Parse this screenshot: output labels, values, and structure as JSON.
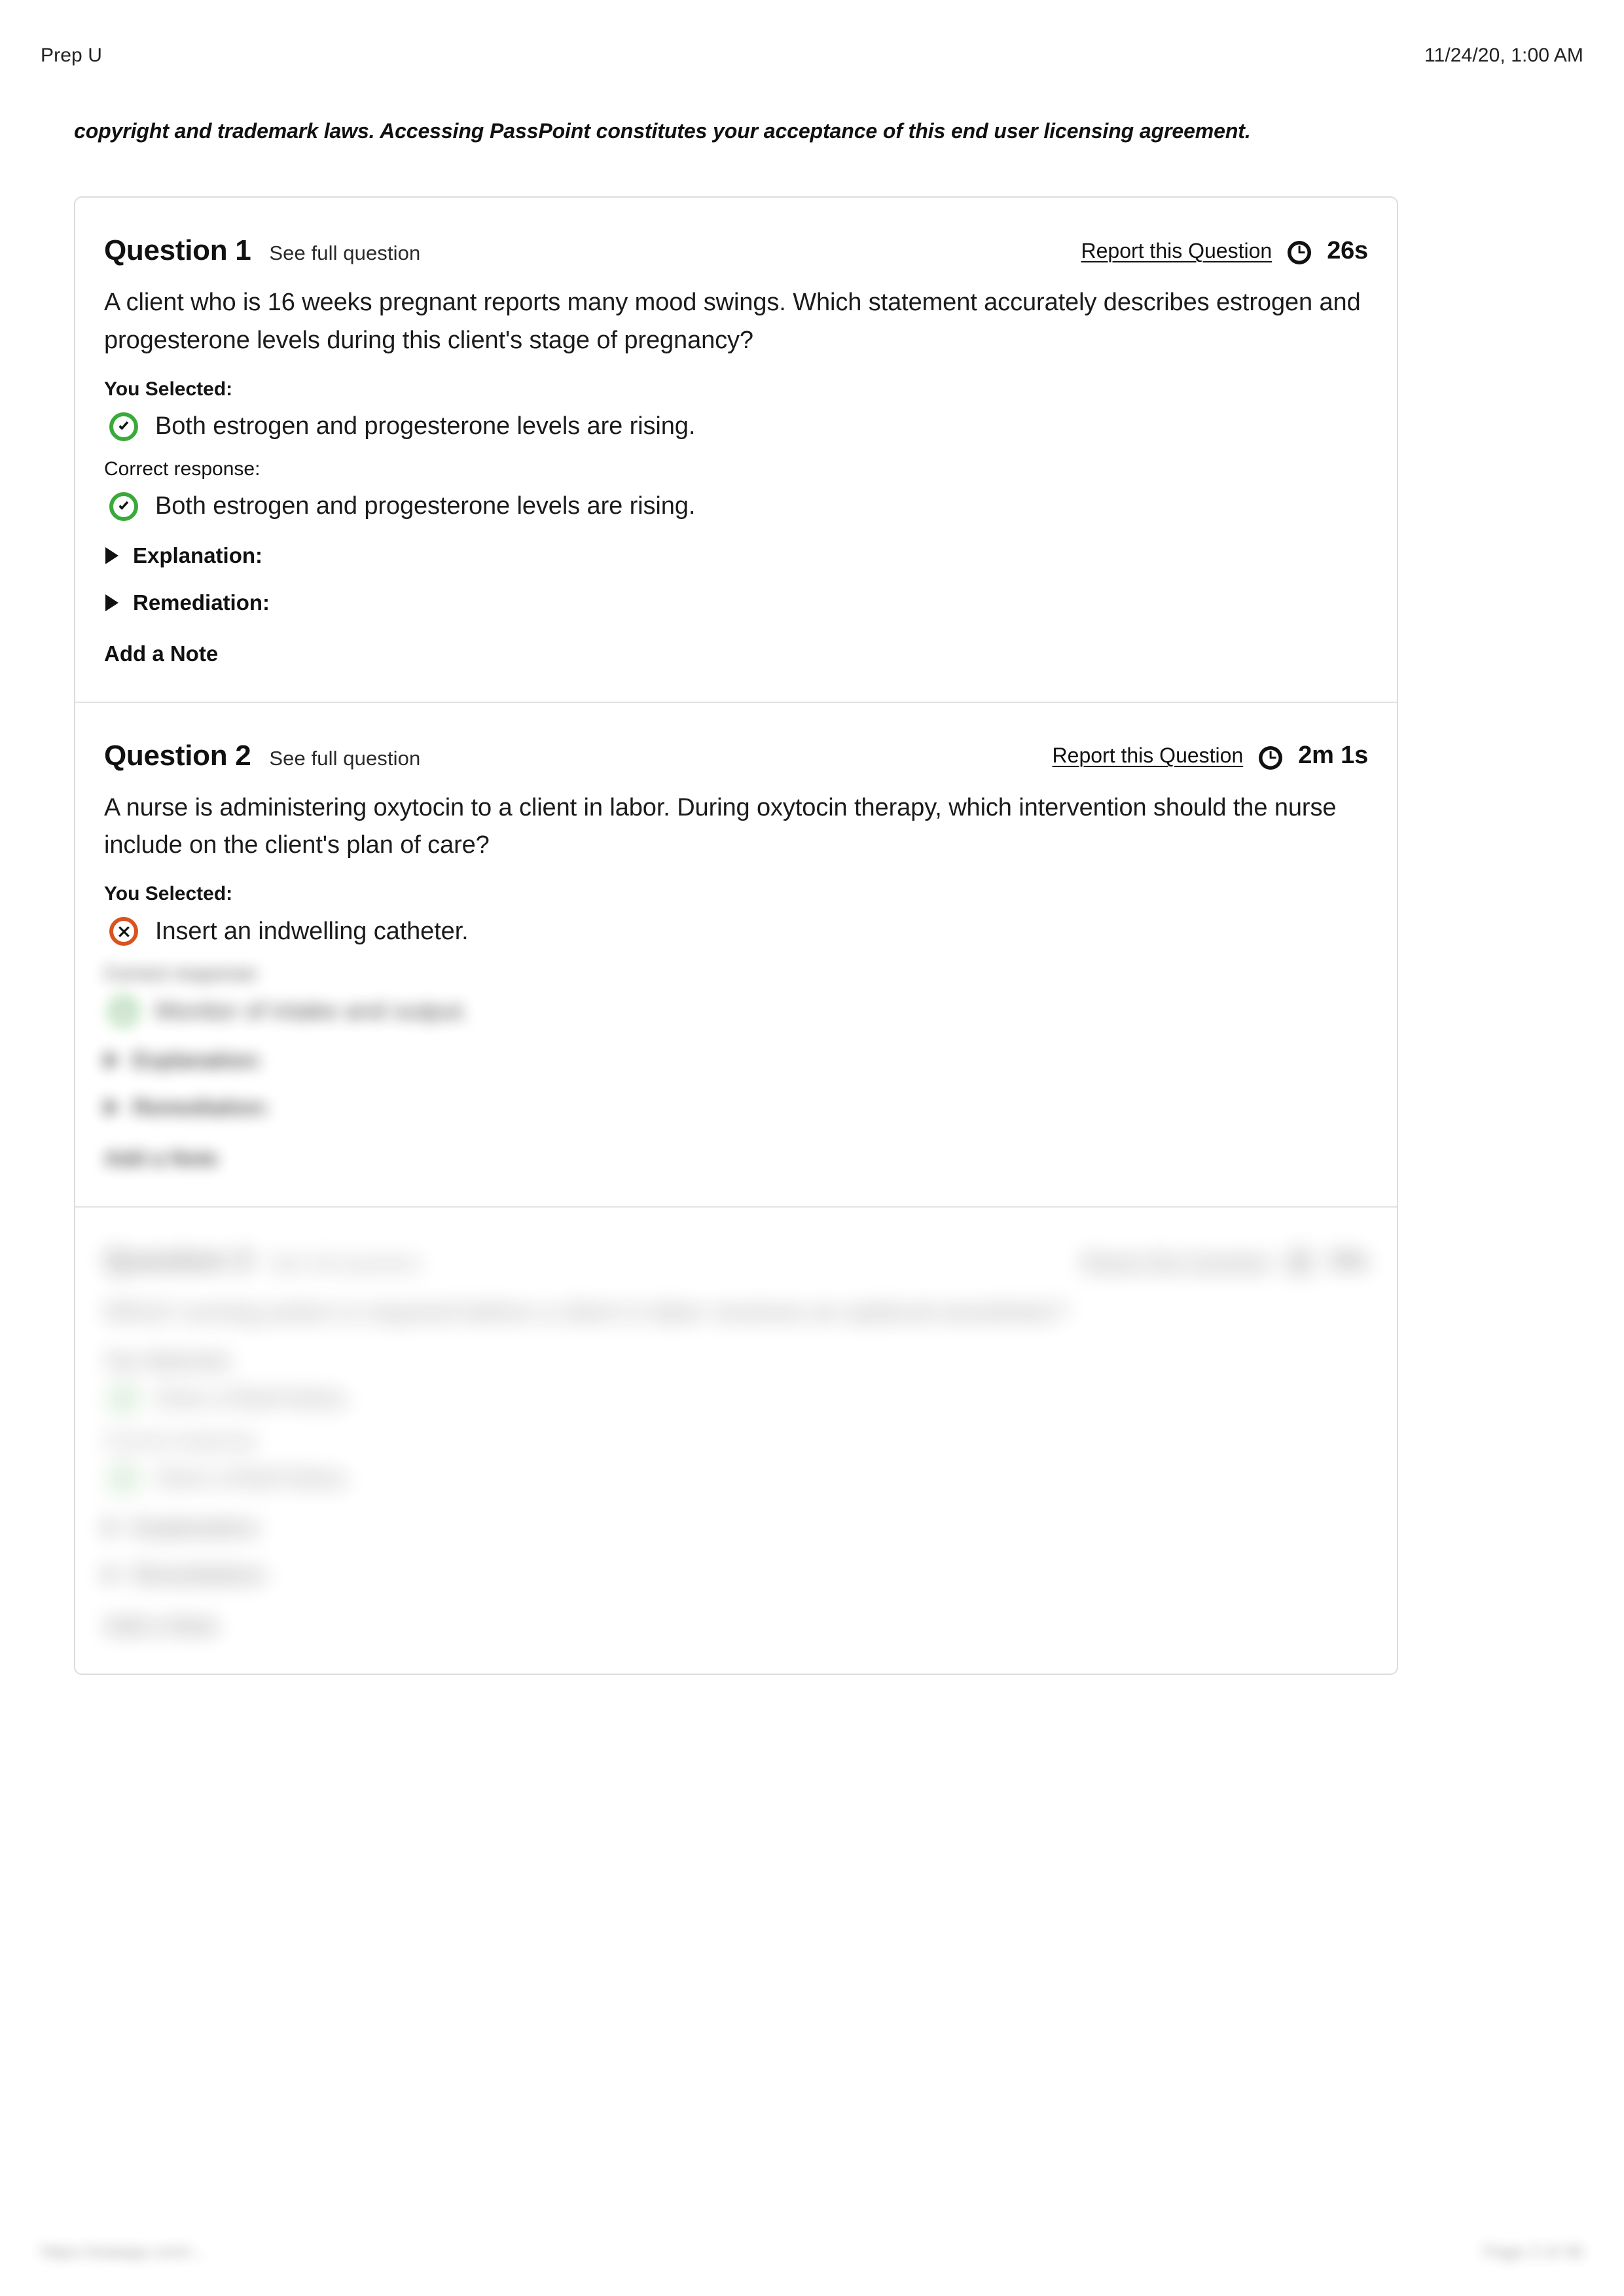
{
  "header": {
    "app_title": "Prep U",
    "timestamp": "11/24/20, 1:00 AM"
  },
  "eula": {
    "tail_text": "copyright and trademark laws. Accessing PassPoint constitutes your acceptance of this end user licensing agreement."
  },
  "labels": {
    "see_full_question": "See full question",
    "report_this_question": "Report this Question",
    "you_selected": "You Selected:",
    "correct_response": "Correct response:",
    "explanation": "Explanation:",
    "remediation": "Remediation:",
    "add_a_note": "Add a Note"
  },
  "colors": {
    "correct_ring": "#3aa93a",
    "incorrect_ring": "#d9531e",
    "card_border": "#dcdcdc",
    "divider": "#e2e2e2",
    "text": "#1b1b1b"
  },
  "icons": {
    "clock": "clock-icon",
    "correct": "check-circle-icon",
    "incorrect": "x-circle-icon",
    "disclosure": "triangle-right-icon"
  },
  "questions": [
    {
      "number": "Question 1",
      "timer": "26s",
      "stem": "A client who is 16 weeks pregnant reports many mood swings. Which statement accurately describes estrogen and progesterone levels during this client's stage of pregnancy?",
      "selected_answer": "Both estrogen and progesterone levels are rising.",
      "selected_status": "correct",
      "correct_answer": "Both estrogen and progesterone levels are rising.",
      "has_correct_section": true,
      "blur": "none"
    },
    {
      "number": "Question 2",
      "timer": "2m 1s",
      "stem": "A nurse is administering oxytocin to a client in labor. During oxytocin therapy, which intervention should the nurse include on the client's plan of care?",
      "selected_answer": "Insert an indwelling catheter.",
      "selected_status": "incorrect",
      "correct_answer": "Monitor of intake and output.",
      "has_correct_section": true,
      "blur": "partial"
    },
    {
      "number": "Question 3",
      "timer": "19s",
      "stem": "Which nursing action is required before a client in labor receives an epidural anesthetic?",
      "selected_answer": "Give a fluid bolus.",
      "selected_status": "correct",
      "correct_answer": "Give a fluid bolus.",
      "has_correct_section": true,
      "blur": "heavy"
    }
  ],
  "footer": {
    "url": "https://eatapp.com/...",
    "page_number": "Page 2 of 46"
  }
}
